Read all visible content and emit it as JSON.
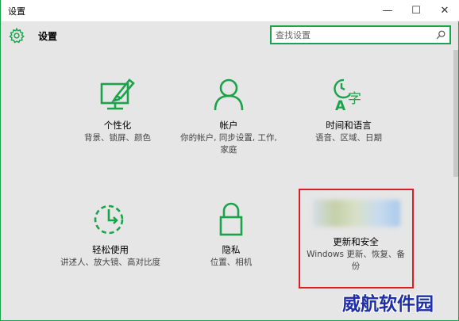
{
  "window": {
    "title": "设置",
    "min_glyph": "—",
    "max_glyph": "☐",
    "close_glyph": "✕"
  },
  "header": {
    "title": "设置",
    "search_placeholder": "查找设置",
    "icon": "gear-icon"
  },
  "tiles": [
    {
      "name": "个性化",
      "desc": "背景、锁屏、颜色",
      "icon": "personalization-icon"
    },
    {
      "name": "帐户",
      "desc": "你的帐户, 同步设置, 工作, 家庭",
      "icon": "account-icon"
    },
    {
      "name": "时间和语言",
      "desc": "语音、区域、日期",
      "icon": "time-language-icon"
    },
    {
      "name": "轻松使用",
      "desc": "讲述人、放大镜、高对比度",
      "icon": "ease-of-access-icon"
    },
    {
      "name": "隐私",
      "desc": "位置、相机",
      "icon": "privacy-icon"
    },
    {
      "name": "更新和安全",
      "desc": "Windows 更新、恢复、备份",
      "icon": "update-security-icon"
    }
  ],
  "colors": {
    "accent": "#1aa34a",
    "highlight": "#d42222",
    "background": "#e6e6e6"
  },
  "watermark": "威航软件园"
}
